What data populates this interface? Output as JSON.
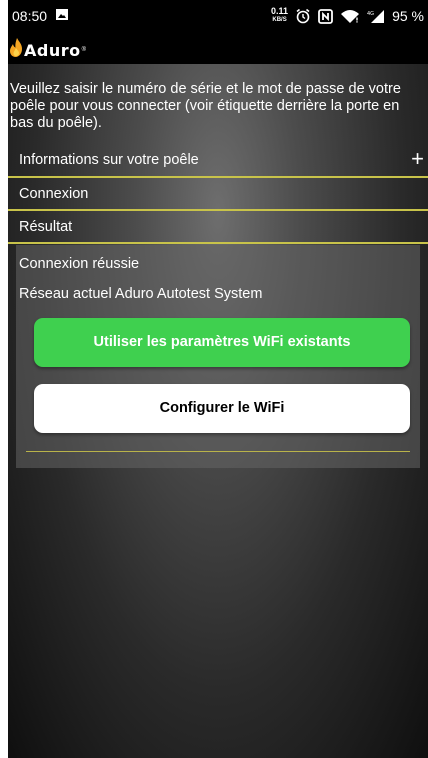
{
  "status_bar": {
    "time": "08:50",
    "net_speed_value": "0.11",
    "net_speed_unit": "KB/S",
    "battery": "95 %",
    "icons": [
      "gallery-icon",
      "alarm-icon",
      "nfc-icon",
      "wifi-icon",
      "signal-icon"
    ]
  },
  "app": {
    "logo_text": "Aduro",
    "logo_reg": "®",
    "flame_color": "#f5a623"
  },
  "intro_text": "Veuillez saisir le numéro de série et le mot de passe de votre poêle pour vous connecter (voir étiquette derrière la porte en bas du poêle).",
  "sections": {
    "info": {
      "label": "Informations sur votre poêle",
      "expand": "+"
    },
    "connexion": {
      "label": "Connexion"
    },
    "resultat": {
      "label": "Résultat"
    }
  },
  "result": {
    "status": "Connexion réussie",
    "network": "Réseau actuel Aduro Autotest System",
    "use_existing_button": "Utiliser les paramètres WiFi existants",
    "configure_button": "Configurer le WiFi"
  },
  "colors": {
    "accent_line": "#c8c34a",
    "green_button": "#3fd04f",
    "white_button": "#ffffff"
  }
}
